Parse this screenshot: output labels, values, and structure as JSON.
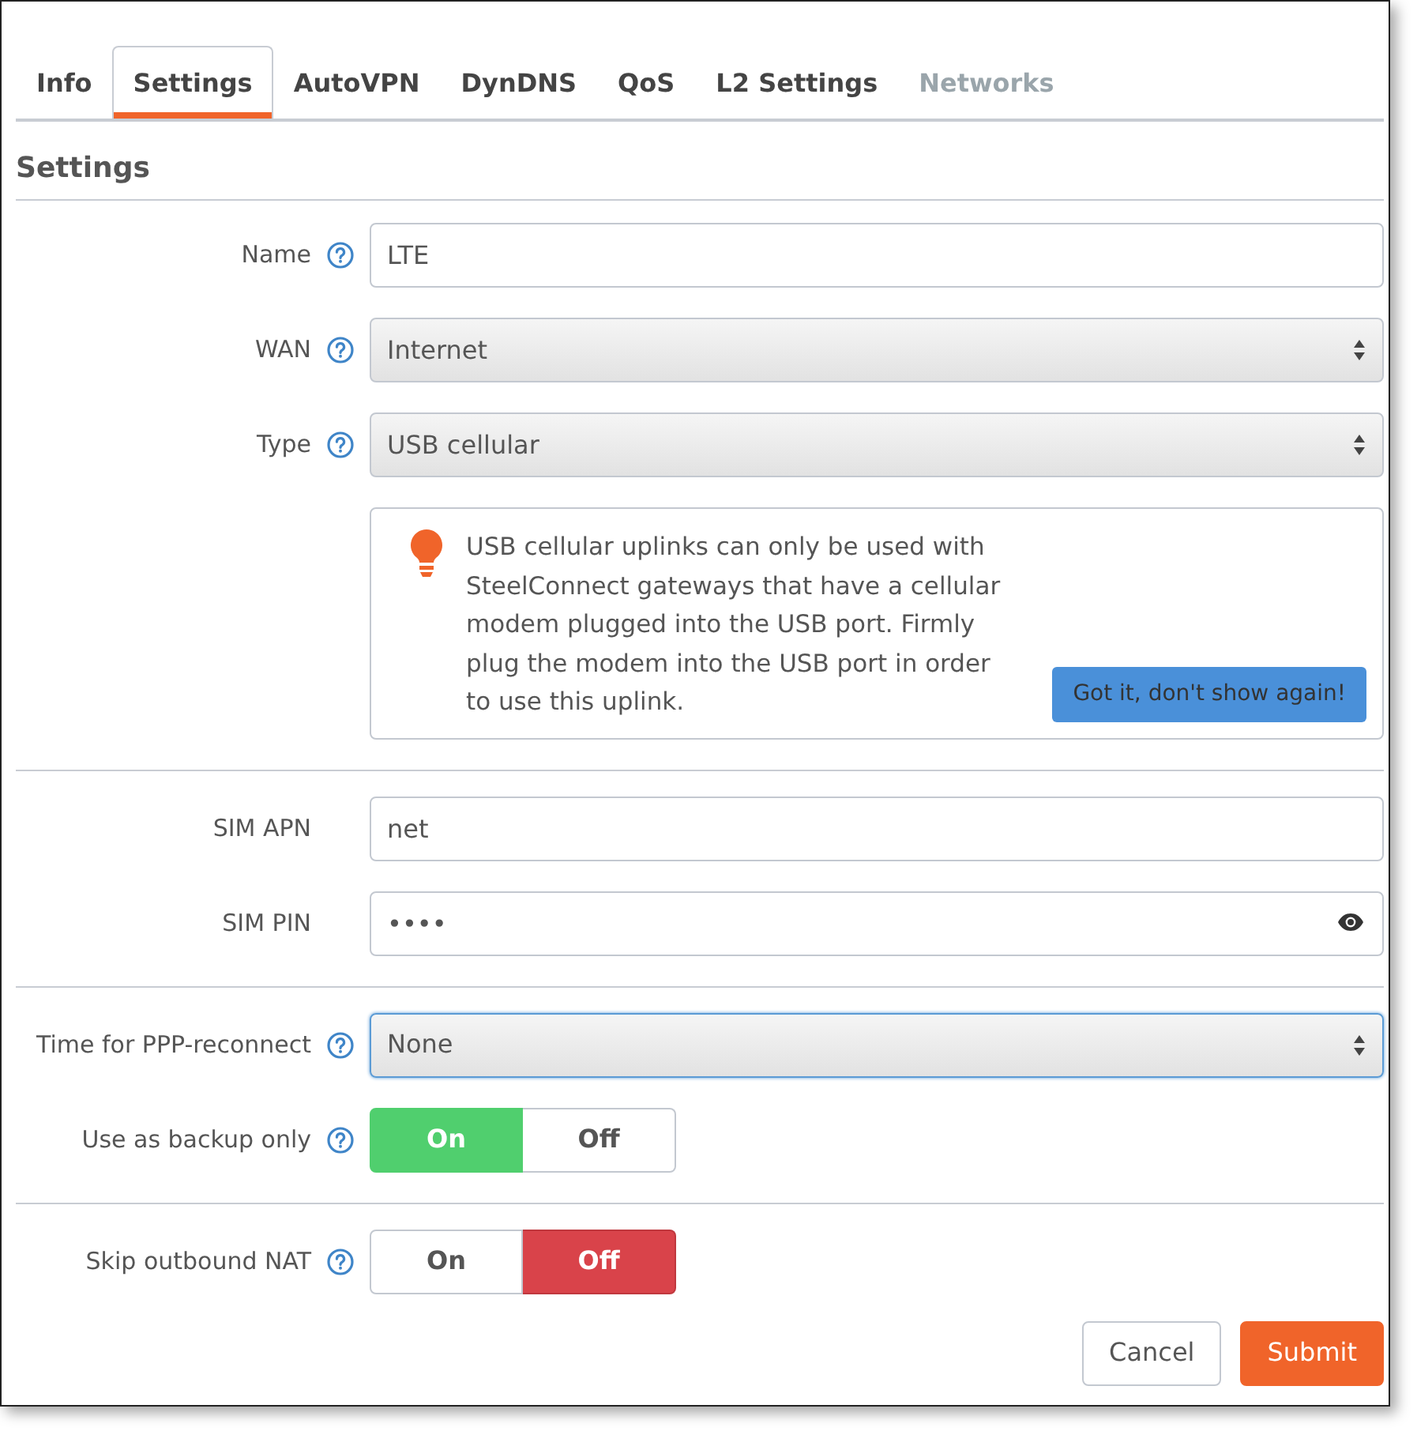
{
  "tabs": [
    {
      "label": "Info",
      "selected": false,
      "disabled": false
    },
    {
      "label": "Settings",
      "selected": true,
      "disabled": false
    },
    {
      "label": "AutoVPN",
      "selected": false,
      "disabled": false
    },
    {
      "label": "DynDNS",
      "selected": false,
      "disabled": false
    },
    {
      "label": "QoS",
      "selected": false,
      "disabled": false
    },
    {
      "label": "L2 Settings",
      "selected": false,
      "disabled": false
    },
    {
      "label": "Networks",
      "selected": false,
      "disabled": true
    }
  ],
  "section_title": "Settings",
  "groups": [
    [
      {
        "kind": "text",
        "label": "Name",
        "help": true,
        "value": "LTE"
      },
      {
        "kind": "select",
        "label": "WAN",
        "help": true,
        "value": "Internet",
        "focused": false
      },
      {
        "kind": "select",
        "label": "Type",
        "help": true,
        "value": "USB cellular",
        "focused": false
      },
      {
        "kind": "notice",
        "text": "USB cellular uplinks can only be used with SteelConnect gateways that have a cellular modem plugged into the USB port. Firmly plug the modem into the USB port in order to use this uplink.",
        "button": "Got it, don't show again!"
      }
    ],
    [
      {
        "kind": "text",
        "label": "SIM APN",
        "help": false,
        "value": "net"
      },
      {
        "kind": "password",
        "label": "SIM PIN",
        "help": false,
        "value": "••••"
      }
    ],
    [
      {
        "kind": "select",
        "label": "Time for PPP-reconnect",
        "help": true,
        "value": "None",
        "focused": true
      },
      {
        "kind": "toggle",
        "label": "Use as backup only",
        "help": true,
        "options": [
          "On",
          "Off"
        ],
        "on": true
      }
    ],
    [
      {
        "kind": "toggle",
        "label": "Skip outbound NAT",
        "help": true,
        "options": [
          "On",
          "Off"
        ],
        "on": false
      }
    ]
  ],
  "actions": [
    {
      "label": "Cancel",
      "kind": "secondary"
    },
    {
      "label": "Submit",
      "kind": "primary"
    }
  ]
}
